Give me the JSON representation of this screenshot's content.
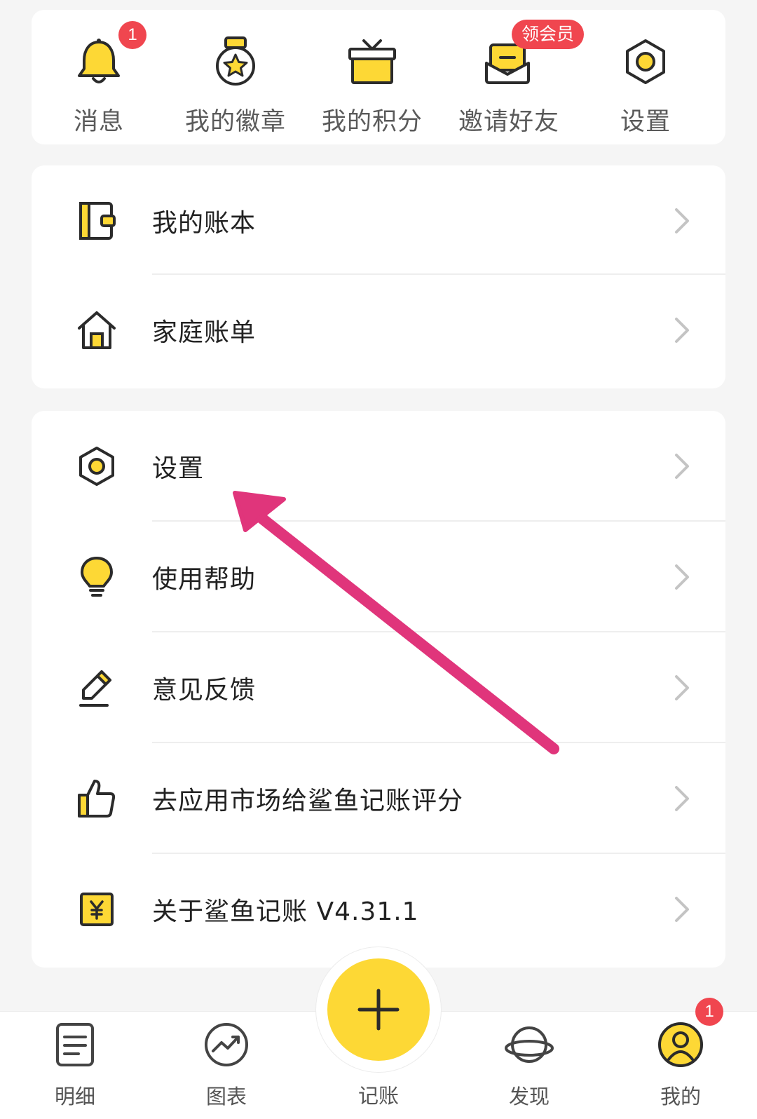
{
  "quick_actions": [
    {
      "label": "消息",
      "icon": "bell-icon",
      "badge": "1"
    },
    {
      "label": "我的徽章",
      "icon": "medal-icon"
    },
    {
      "label": "我的积分",
      "icon": "gift-icon"
    },
    {
      "label": "邀请好友",
      "icon": "envelope-icon",
      "badge": "领会员"
    },
    {
      "label": "设置",
      "icon": "gear-icon"
    }
  ],
  "ledger_list": [
    {
      "label": "我的账本",
      "icon": "ledger-book-icon"
    },
    {
      "label": "家庭账单",
      "icon": "house-icon"
    }
  ],
  "settings_list": [
    {
      "label": "设置",
      "icon": "gear-icon"
    },
    {
      "label": "使用帮助",
      "icon": "lightbulb-icon"
    },
    {
      "label": "意见反馈",
      "icon": "pencil-icon"
    },
    {
      "label": "去应用市场给鲨鱼记账评分",
      "icon": "thumbs-up-icon"
    },
    {
      "label": "关于鲨鱼记账 V4.31.1",
      "icon": "yuan-icon"
    }
  ],
  "tabbar": {
    "tabs": [
      {
        "label": "明细",
        "icon": "document-icon"
      },
      {
        "label": "图表",
        "icon": "chart-icon"
      },
      {
        "label": "发现",
        "icon": "planet-icon"
      },
      {
        "label": "我的",
        "icon": "user-icon",
        "badge": "1"
      }
    ],
    "center": {
      "label": "记账",
      "icon": "plus-icon"
    }
  },
  "colors": {
    "accent": "#fdd835",
    "badge": "#f0464f",
    "annotation_arrow": "#e0357b",
    "background": "#f5f5f5"
  }
}
